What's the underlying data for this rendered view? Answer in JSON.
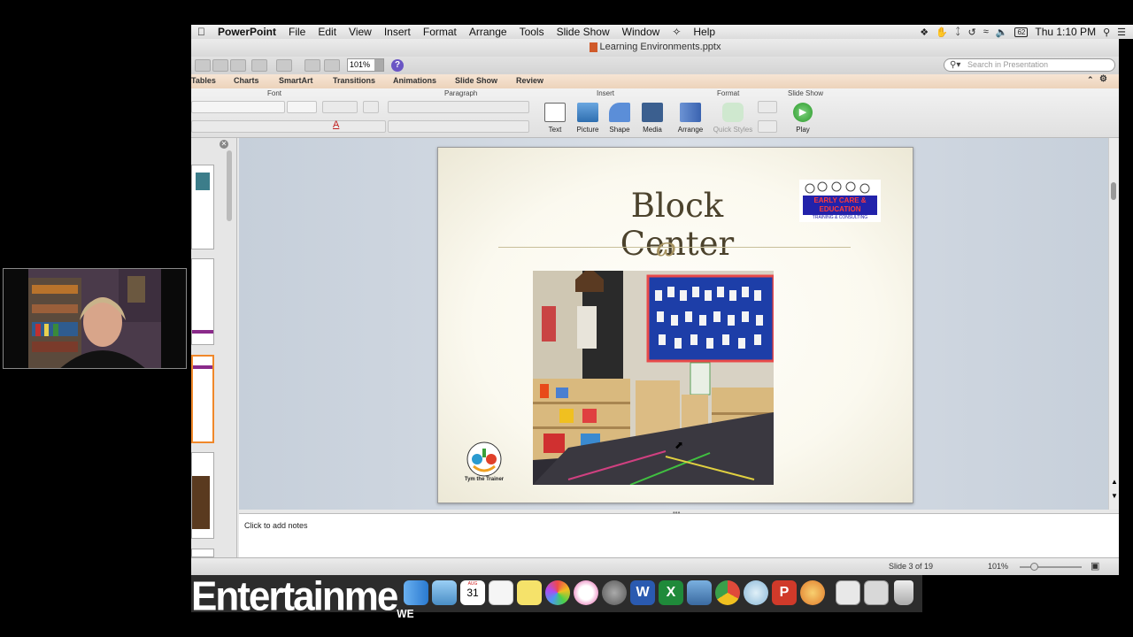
{
  "menubar": {
    "apple": "",
    "items": [
      "PowerPoint",
      "File",
      "Edit",
      "View",
      "Insert",
      "Format",
      "Arrange",
      "Tools",
      "Slide Show",
      "Window",
      "Help"
    ],
    "battery": "62",
    "clock": "Thu 1:10 PM",
    "status_icons": [
      "dropbox-icon",
      "bluetooth-icon",
      "time-machine-icon",
      "wifi-icon",
      "volume-icon",
      "battery-icon",
      "spotlight-icon",
      "notification-center-icon"
    ]
  },
  "window": {
    "title": "Learning Environments.pptx"
  },
  "toolbar": {
    "zoom": "101%",
    "help": "?",
    "search_placeholder": "Search in Presentation"
  },
  "ribbon_tabs": [
    "Tables",
    "Charts",
    "SmartArt",
    "Transitions",
    "Animations",
    "Slide Show",
    "Review"
  ],
  "ribbon_groups": {
    "font": "Font",
    "paragraph": "Paragraph",
    "insert": "Insert",
    "format": "Format",
    "slide_show": "Slide Show"
  },
  "ribbon_buttons": {
    "text": "Text",
    "picture": "Picture",
    "shape": "Shape",
    "media": "Media",
    "arrange": "Arrange",
    "quick_styles": "Quick Styles",
    "play": "Play"
  },
  "slide": {
    "title": "Block Center",
    "flourish": "ɷ",
    "logo_ece_text": "EARLY CARE & EDUCATION",
    "logo_ece_sub": "TRAINING & CONSULTING",
    "logo_tym_text": "Tym the Trainer"
  },
  "notes": {
    "placeholder": "Click to add notes"
  },
  "statusbar": {
    "slide_indicator": "Slide 3 of 19",
    "zoom": "101%"
  },
  "dock": {
    "banner_text": "Entertainme",
    "banner_tail": "WE",
    "calendar_month": "AUG",
    "calendar_day": "31",
    "apps": [
      "finder-icon",
      "mail-icon",
      "calendar-icon",
      "notes-icon",
      "stickies-icon",
      "photos-icon",
      "itunes-icon",
      "system-preferences-icon",
      "word-icon",
      "excel-icon",
      "powerpoint-icon",
      "chrome-icon",
      "network-icon",
      "presenter-icon",
      "flower-app-icon",
      "documents-icon",
      "window-icon",
      "trash-icon"
    ]
  }
}
